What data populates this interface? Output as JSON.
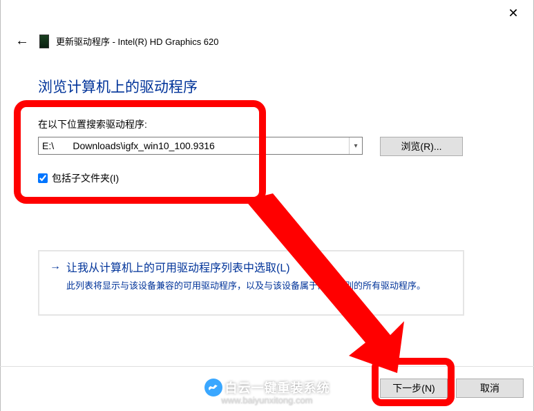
{
  "window": {
    "close_icon": "✕"
  },
  "header": {
    "back_icon": "←",
    "title": "更新驱动程序 - Intel(R) HD Graphics 620"
  },
  "main": {
    "heading": "浏览计算机上的驱动程序",
    "search_label": "在以下位置搜索驱动程序:",
    "path_value": "E:\\       Downloads\\igfx_win10_100.9316",
    "browse_button": "浏览(R)...",
    "include_subfolders_checked": true,
    "include_subfolders_label": "包括子文件夹(I)"
  },
  "option": {
    "arrow": "→",
    "title": "让我从计算机上的可用驱动程序列表中选取(L)",
    "description": "此列表将显示与该设备兼容的可用驱动程序，以及与该设备属于同一类别的所有驱动程序。"
  },
  "footer": {
    "next_button": "下一步(N)",
    "cancel_button": "取消"
  },
  "watermark": {
    "text": "白云一键重装系统",
    "url": "www.baiyunxitong.com"
  },
  "annotation": {
    "highlight_color": "#ff0000"
  }
}
